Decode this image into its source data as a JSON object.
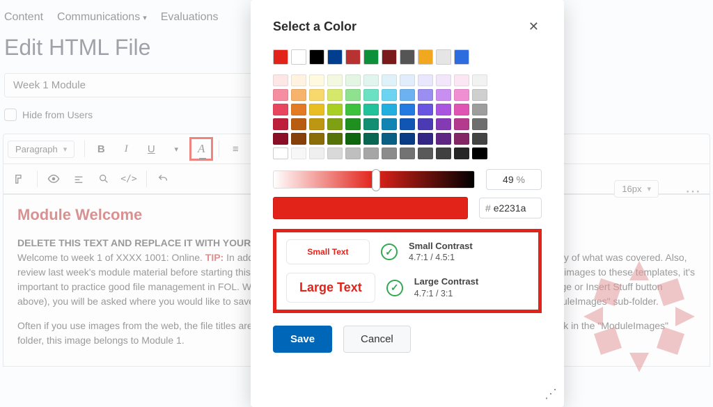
{
  "nav": {
    "content": "Content",
    "comms": "Communications",
    "evals": "Evaluations"
  },
  "page_title": "Edit HTML File",
  "title_input": {
    "value": "Week 1 Module"
  },
  "hide_label": "Hide from Users",
  "toolbar": {
    "paragraph": "Paragraph",
    "font_size": "16px"
  },
  "editor": {
    "heading": "Module Welcome",
    "delete_line": "DELETE THIS TEXT AND REPLACE IT WITH YOUR",
    "para1_a": "Welcome to week 1 of XXXX 1001: Online. ",
    "tip": "TIP:",
    "para1_b": " In addition to your weekly module content, to provide a brief review or summary of what was covered. Also, review last week's module material before starting this module's content if they relate. When adding text, images and files, and images to these templates, it's important to practice good file management in FOL. When you add an image or a file directly to this page (using the Insert Image or Insert Stuff button above), you will be asked where you would like to save the file. Save images to the \"WeeklyModules\" folder and then the \"ModuleImages\" sub-folder.",
    "para2": "Often if you use images from the web, the file titles are not intuitive. Please rename them to \"M1FanshaweNorthstar.\" If you look in the \"ModuleImages\" folder, this image belongs to Module 1."
  },
  "dialog": {
    "title": "Select a Color",
    "percent_value": "49",
    "percent_suffix": "%",
    "hex_prefix": "#",
    "hex_value": "e2231a",
    "small_text": "Small Text",
    "large_text": "Large Text",
    "small_label": "Small Contrast",
    "small_ratio": "4.7:1 / 4.5:1",
    "large_label": "Large Contrast",
    "large_ratio": "4.7:1 / 3:1",
    "save": "Save",
    "cancel": "Cancel",
    "basic_colors": [
      "#e2231a",
      "#ffffff",
      "#000000",
      "#003f8f",
      "#b83232",
      "#0e8f3a",
      "#7a1a1a",
      "#555555",
      "#f1a81f",
      "#e5e5e5",
      "#2d6cdf"
    ],
    "palette": [
      [
        "#fde6e6",
        "#fff2df",
        "#fff9df",
        "#f2f9e0",
        "#e3f5e3",
        "#dff5ee",
        "#dff2f9",
        "#e2edfb",
        "#e9e7fb",
        "#f2e6fb",
        "#fbe6f4",
        "#f2f2f2"
      ],
      [
        "#f58ea0",
        "#f7b26c",
        "#f7d86c",
        "#d5e86b",
        "#8fe08f",
        "#6be0c2",
        "#6cd4f0",
        "#6cb2f0",
        "#9a8ff0",
        "#c98ff0",
        "#f08fd1",
        "#cfcfcf"
      ],
      [
        "#e8455f",
        "#e27b23",
        "#e8be23",
        "#aacf23",
        "#3ec23e",
        "#23c29a",
        "#23aee0",
        "#237ae0",
        "#6a55e0",
        "#a955e0",
        "#e055b4",
        "#9e9e9e"
      ],
      [
        "#bd1f3a",
        "#b85c12",
        "#bd9712",
        "#7ea012",
        "#1f8f1f",
        "#128f72",
        "#1284b3",
        "#1256b3",
        "#4a3ab3",
        "#833ab3",
        "#b33a8d",
        "#6e6e6e"
      ],
      [
        "#8a0f26",
        "#874009",
        "#8a6c09",
        "#567309",
        "#0f660f",
        "#096652",
        "#095f84",
        "#093c84",
        "#332684",
        "#5f2684",
        "#842666",
        "#444444"
      ],
      [
        "#ffffff",
        "#f7f7f7",
        "#efefef",
        "#d9d9d9",
        "#bfbfbf",
        "#a6a6a6",
        "#8c8c8c",
        "#737373",
        "#595959",
        "#404040",
        "#262626",
        "#000000"
      ]
    ]
  }
}
